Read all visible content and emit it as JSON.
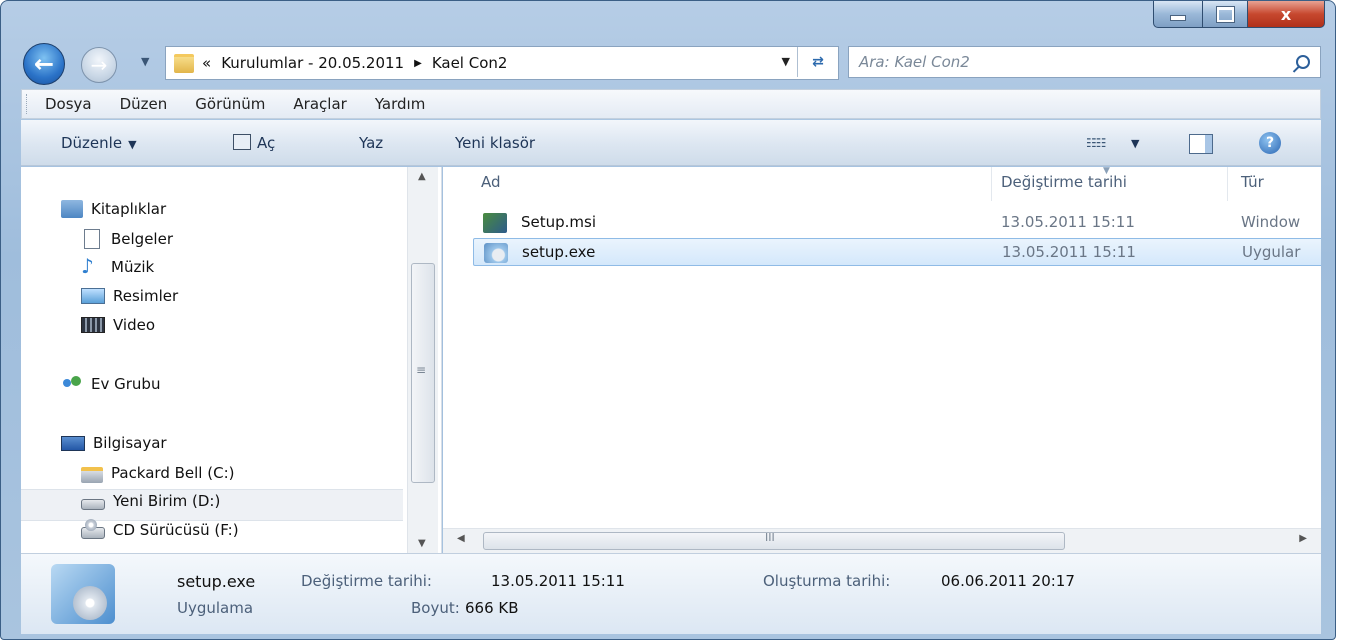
{
  "window": {
    "close_glyph": "x"
  },
  "address": {
    "prefix": "«",
    "crumbs": [
      "Kurulumlar - 20.05.2011",
      "Kael Con2"
    ]
  },
  "search": {
    "placeholder": "Ara: Kael Con2"
  },
  "menu": [
    "Dosya",
    "Düzen",
    "Görünüm",
    "Araçlar",
    "Yardım"
  ],
  "commands": {
    "organize": "Düzenle",
    "open": "Aç",
    "burn": "Yaz",
    "new_folder": "Yeni klasör"
  },
  "nav": {
    "libraries": "Kitaplıklar",
    "documents": "Belgeler",
    "music": "Müzik",
    "pictures": "Resimler",
    "video": "Video",
    "homegroup": "Ev Grubu",
    "computer": "Bilgisayar",
    "drive_c": "Packard Bell (C:)",
    "drive_d": "Yeni Birim (D:)",
    "drive_f": "CD Sürücüsü (F:)"
  },
  "columns": {
    "name": "Ad",
    "modified": "Değiştirme tarihi",
    "type": "Tür"
  },
  "files": [
    {
      "name": "Setup.msi",
      "modified": "13.05.2011 15:11",
      "type": "Window"
    },
    {
      "name": "setup.exe",
      "modified": "13.05.2011 15:11",
      "type": "Uygular"
    }
  ],
  "details": {
    "name": "setup.exe",
    "modified_label": "Değiştirme tarihi:",
    "modified_value": "13.05.2011 15:11",
    "created_label": "Oluşturma tarihi:",
    "created_value": "06.06.2011 20:17",
    "kind": "Uygulama",
    "size_label": "Boyut:",
    "size_value": "666 KB"
  },
  "colors": {
    "accent": "#2b73c8",
    "selection": "#d4e8fb",
    "close": "#c7482f"
  }
}
